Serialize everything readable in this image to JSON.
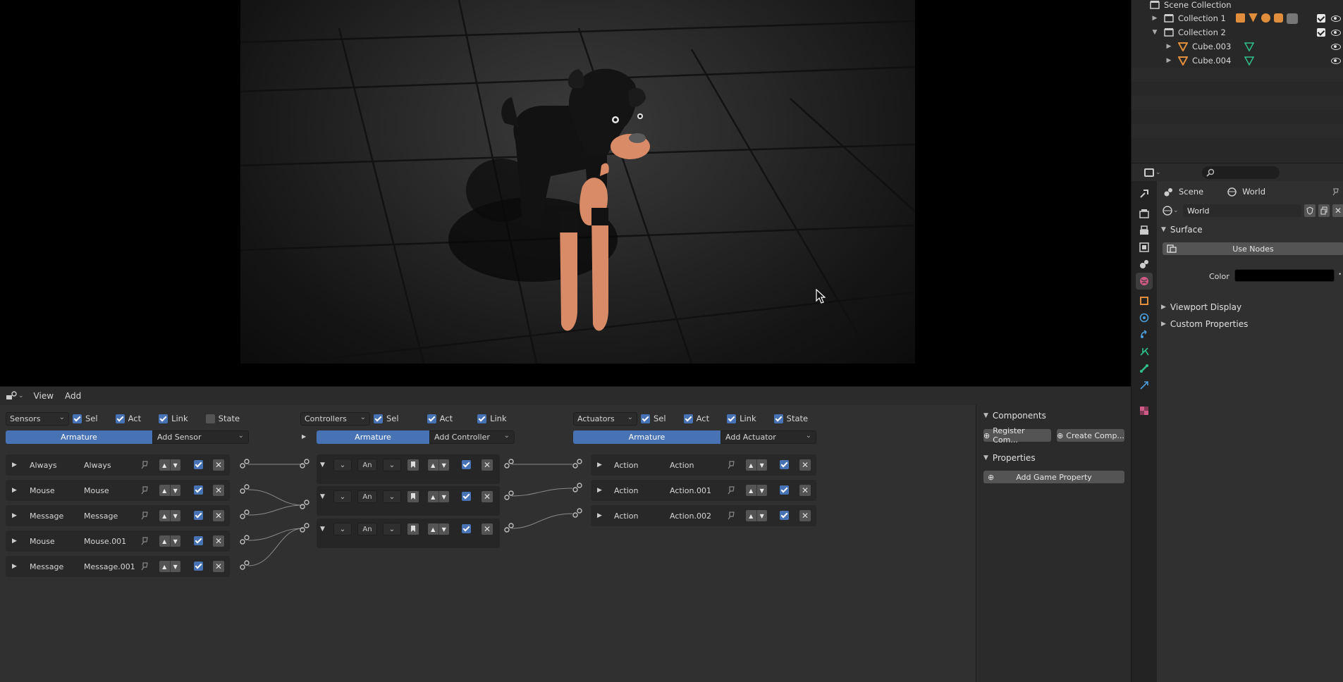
{
  "outliner": {
    "rows": [
      {
        "label": "Scene Collection"
      },
      {
        "label": "Collection 1"
      },
      {
        "label": "Collection 2"
      },
      {
        "label": "Cube.003"
      },
      {
        "label": "Cube.004"
      }
    ]
  },
  "properties": {
    "breadcrumb": {
      "scene": "Scene",
      "world": "World"
    },
    "world_name": "World",
    "surface_label": "Surface",
    "use_nodes_label": "Use Nodes",
    "color_label": "Color",
    "color_value": "#000000",
    "viewport_display_label": "Viewport Display",
    "custom_properties_label": "Custom Properties"
  },
  "logic": {
    "menu": {
      "view": "View",
      "add": "Add"
    },
    "sensors": {
      "dropdown": "Sensors",
      "sel": "Sel",
      "act": "Act",
      "link": "Link",
      "state": "State",
      "object": "Armature",
      "add": "Add Sensor",
      "bricks": [
        {
          "type": "Always",
          "name": "Always"
        },
        {
          "type": "Mouse",
          "name": "Mouse"
        },
        {
          "type": "Message",
          "name": "Message"
        },
        {
          "type": "Mouse",
          "name": "Mouse.001"
        },
        {
          "type": "Message",
          "name": "Message.001"
        }
      ]
    },
    "controllers": {
      "dropdown": "Controllers",
      "sel": "Sel",
      "act": "Act",
      "link": "Link",
      "object": "Armature",
      "add": "Add Controller",
      "bricks": [
        {
          "type": "An"
        },
        {
          "type": "An"
        },
        {
          "type": "An"
        }
      ]
    },
    "actuators": {
      "dropdown": "Actuators",
      "sel": "Sel",
      "act": "Act",
      "link": "Link",
      "state": "State",
      "object": "Armature",
      "add": "Add Actuator",
      "bricks": [
        {
          "type": "Action",
          "name": "Action"
        },
        {
          "type": "Action",
          "name": "Action.001"
        },
        {
          "type": "Action",
          "name": "Action.002"
        }
      ]
    },
    "side": {
      "components": "Components",
      "register": "Register Com...",
      "create": "Create Comp...",
      "properties": "Properties",
      "add_property": "Add Game Property"
    }
  },
  "colors": {
    "accent": "#4772b3",
    "panel": "#303030",
    "header": "#2b2b2b",
    "dog_tan": "#d98a66"
  }
}
